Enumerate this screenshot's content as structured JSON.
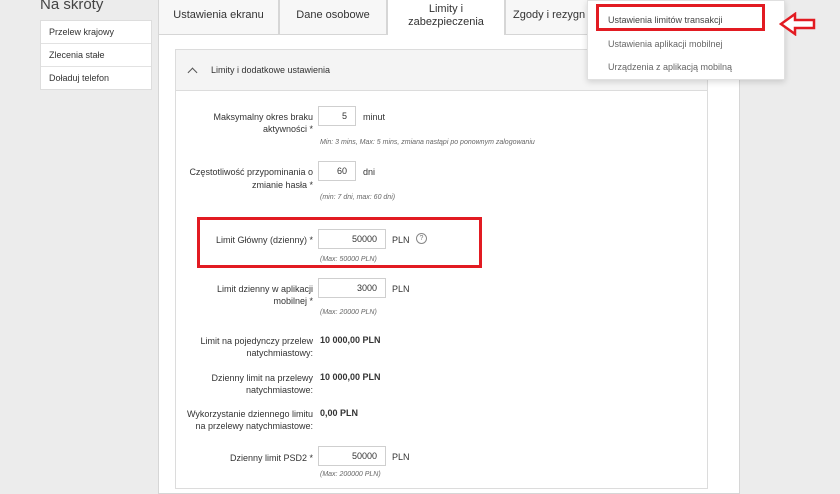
{
  "shortcuts": {
    "title": "Na skróty",
    "items": [
      {
        "label": "Przelew krajowy"
      },
      {
        "label": "Zlecenia stałe"
      },
      {
        "label": "Doładuj telefon"
      }
    ]
  },
  "tabs": [
    {
      "label": "Ustawienia ekranu"
    },
    {
      "label": "Dane osobowe"
    },
    {
      "label": "Limity i\nzabezpieczenia"
    },
    {
      "label": "Zgody i rezygn"
    }
  ],
  "section": {
    "title": "Limity i dodatkowe ustawienia",
    "fields": [
      {
        "label": "Maksymalny okres braku\naktywności *",
        "value": "5",
        "unit": "minut",
        "hint": "Min: 3 mins, Max: 5 mins, zmiana nastąpi po ponownym zalogowaniu"
      },
      {
        "label": "Częstotliwość przypominania o\nzmianie hasła *",
        "value": "60",
        "unit": "dni",
        "hint": "(min: 7 dni, max: 60 dni)"
      },
      {
        "label": "Limit Główny (dzienny) *",
        "value": "50000",
        "unit": "PLN",
        "hint": "(Max: 50000 PLN)"
      },
      {
        "label": "Limit dzienny w aplikacji\nmobilnej *",
        "value": "3000",
        "unit": "PLN",
        "hint": "(Max: 20000 PLN)"
      },
      {
        "label": "Dzienny limit PSD2 *",
        "value": "50000",
        "unit": "PLN",
        "hint": "(Max: 200000 PLN)"
      }
    ],
    "readonly": [
      {
        "label": "Limit na pojedynczy przelew\nnatychmiastowy:",
        "value": "10 000,00 PLN"
      },
      {
        "label": "Dzienny limit na przelewy\nnatychmiastowe:",
        "value": "10 000,00 PLN"
      },
      {
        "label": "Wykorzystanie dziennego limitu\nna przelewy natychmiastowe:",
        "value": "0,00 PLN"
      }
    ]
  },
  "dropdown": {
    "items": [
      {
        "label": "Ustawienia limitów transakcji"
      },
      {
        "label": "Ustawienia aplikacji mobilnej"
      },
      {
        "label": "Urządzenia z aplikacją mobilną"
      }
    ]
  },
  "help_icon": {
    "glyph": "?"
  },
  "colors": {
    "highlight": "#e21b22"
  }
}
